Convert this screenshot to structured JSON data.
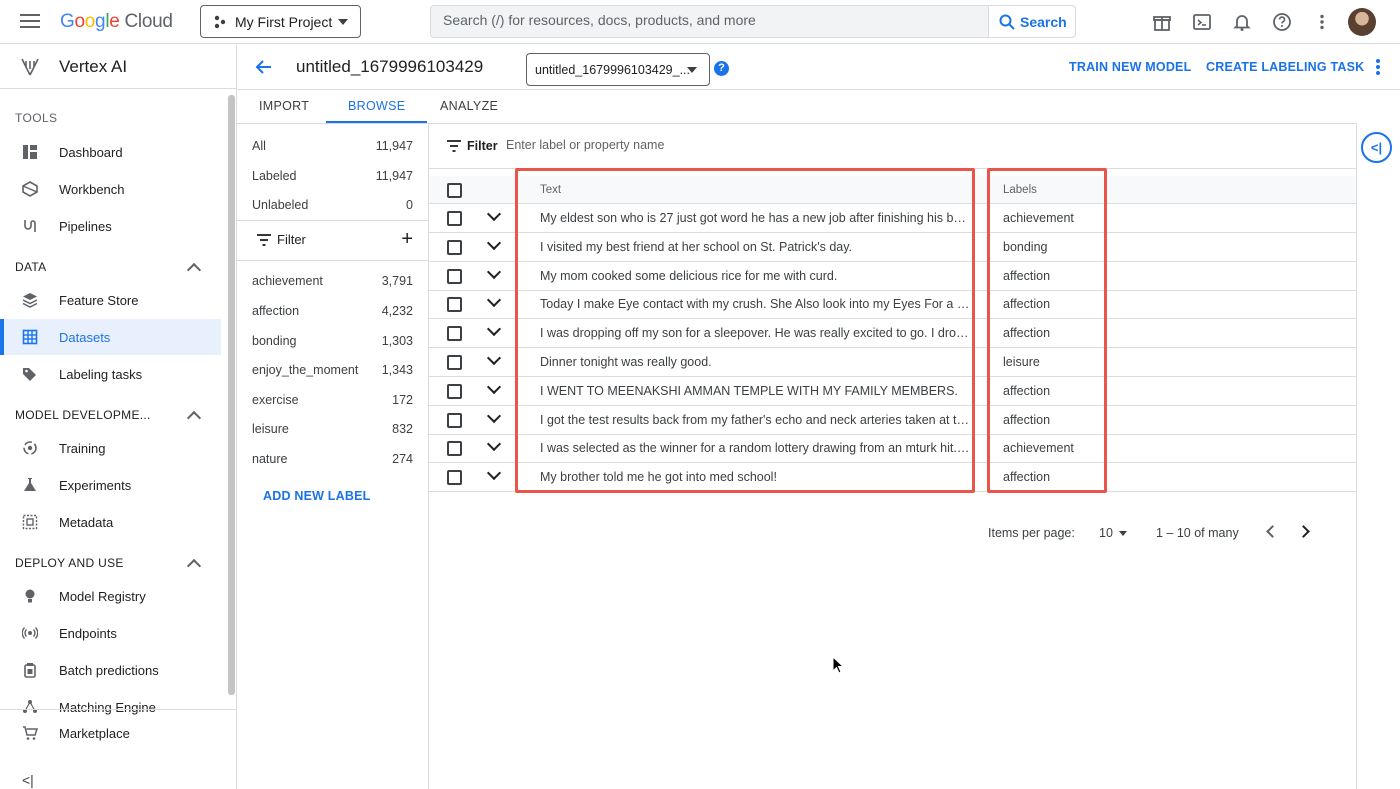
{
  "topbar": {
    "logo_google": "Google",
    "logo_cloud": "Cloud",
    "project": "My First Project",
    "search_placeholder": "Search (/) for resources, docs, products, and more",
    "search_button": "Search"
  },
  "sidebar": {
    "product": "Vertex AI",
    "tools_label": "TOOLS",
    "tools": [
      {
        "label": "Dashboard",
        "icon": "dashboard-icon"
      },
      {
        "label": "Workbench",
        "icon": "workbench-icon"
      },
      {
        "label": "Pipelines",
        "icon": "pipelines-icon"
      }
    ],
    "data_label": "DATA",
    "data": [
      {
        "label": "Feature Store",
        "icon": "feature-store-icon"
      },
      {
        "label": "Datasets",
        "icon": "datasets-icon",
        "active": true
      },
      {
        "label": "Labeling tasks",
        "icon": "label-tag-icon"
      }
    ],
    "model_label": "MODEL DEVELOPME...",
    "model": [
      {
        "label": "Training",
        "icon": "training-icon"
      },
      {
        "label": "Experiments",
        "icon": "flask-icon"
      },
      {
        "label": "Metadata",
        "icon": "metadata-icon"
      }
    ],
    "deploy_label": "DEPLOY AND USE",
    "deploy": [
      {
        "label": "Model Registry",
        "icon": "bulb-icon"
      },
      {
        "label": "Endpoints",
        "icon": "endpoints-icon"
      },
      {
        "label": "Batch predictions",
        "icon": "batch-icon"
      },
      {
        "label": "Matching Engine",
        "icon": "matching-icon"
      }
    ],
    "marketplace": "Marketplace",
    "collapse_glyph": "<|"
  },
  "header": {
    "title": "untitled_1679996103429",
    "version": "untitled_1679996103429_...",
    "help_glyph": "?",
    "train_button": "TRAIN NEW MODEL",
    "labeling_button": "CREATE LABELING TASK"
  },
  "tabs": [
    "IMPORT",
    "BROWSE",
    "ANALYZE"
  ],
  "label_panel": {
    "summary": [
      {
        "label": "All",
        "count": "11,947"
      },
      {
        "label": "Labeled",
        "count": "11,947"
      },
      {
        "label": "Unlabeled",
        "count": "0"
      }
    ],
    "filter_label": "Filter",
    "add_glyph": "+",
    "labels": [
      {
        "label": "achievement",
        "count": "3,791"
      },
      {
        "label": "affection",
        "count": "4,232"
      },
      {
        "label": "bonding",
        "count": "1,303"
      },
      {
        "label": "enjoy_the_moment",
        "count": "1,343"
      },
      {
        "label": "exercise",
        "count": "172"
      },
      {
        "label": "leisure",
        "count": "832"
      },
      {
        "label": "nature",
        "count": "274"
      }
    ],
    "add_new_label": "ADD NEW LABEL"
  },
  "filterbar": {
    "label": "Filter",
    "placeholder": "Enter label or property name"
  },
  "table": {
    "col_text": "Text",
    "col_labels": "Labels",
    "rows": [
      {
        "text": "My eldest son who is 27 just got word he has a new job after finishing his bachelor's degree.",
        "label": "achievement"
      },
      {
        "text": "I visited my best friend at her school on St. Patrick's day.",
        "label": "bonding"
      },
      {
        "text": "My mom cooked some delicious rice for me with curd.",
        "label": "affection"
      },
      {
        "text": "Today I make Eye contact with my crush. She Also look into my Eyes For a Second.",
        "label": "affection"
      },
      {
        "text": "I was dropping off my son for a sleepover. He was really excited to go. I dropped him off.",
        "label": "affection"
      },
      {
        "text": "Dinner tonight was really good.",
        "label": "leisure"
      },
      {
        "text": "I WENT TO MEENAKSHI AMMAN TEMPLE WITH MY FAMILY MEMBERS.",
        "label": "affection"
      },
      {
        "text": "I got the test results back from my father's echo and neck arteries taken at the hospital.",
        "label": "affection"
      },
      {
        "text": "I was selected as the winner for a random lottery drawing from an mturk hit. It was great.",
        "label": "achievement"
      },
      {
        "text": "My brother told me he got into med school!",
        "label": "affection"
      }
    ]
  },
  "pager": {
    "items_per_page_label": "Items per page:",
    "items_per_page": "10",
    "range": "1 – 10 of many"
  },
  "rightrail": {
    "toggle_glyph": "<|"
  },
  "colors": {
    "accent": "#1a73e8",
    "highlight": "#e8554a"
  }
}
